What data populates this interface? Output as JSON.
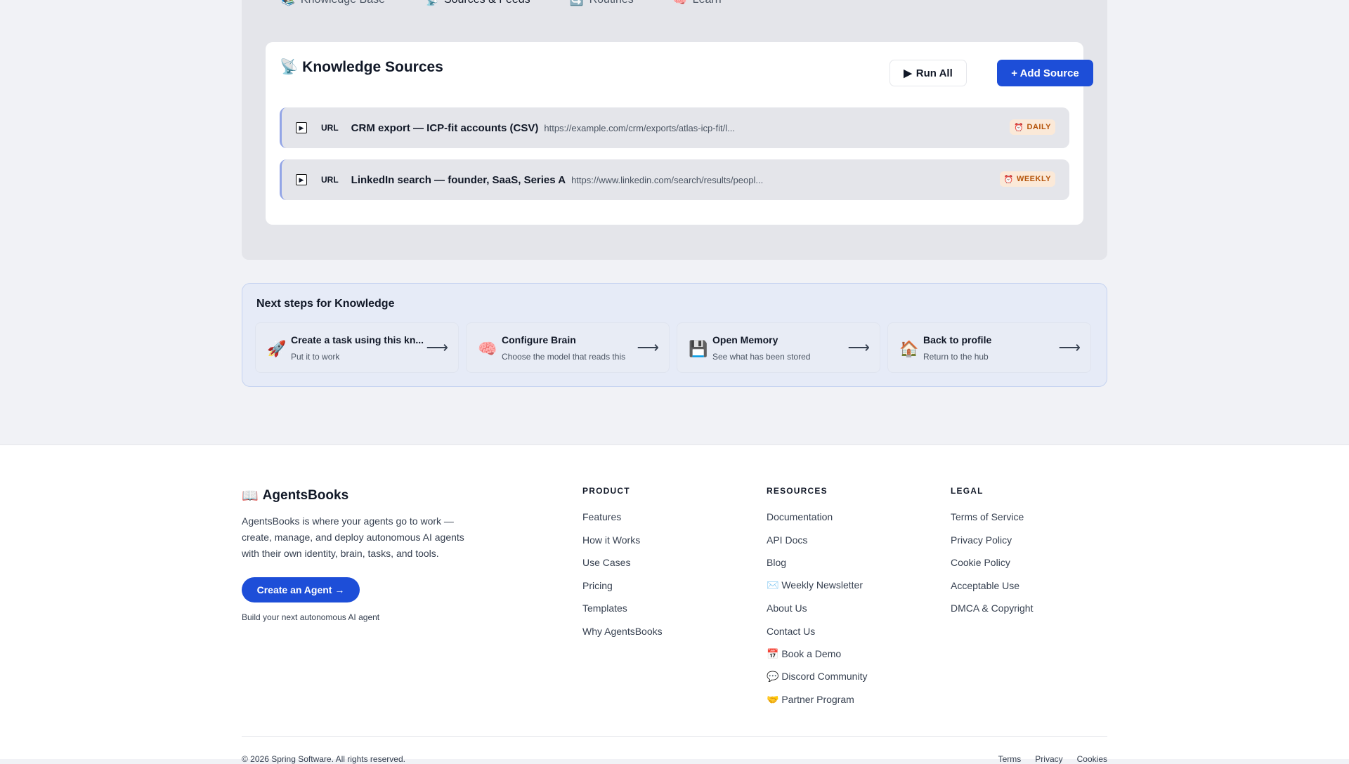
{
  "tabs": [
    {
      "icon": "📚",
      "label": "Knowledge Base"
    },
    {
      "icon": "📡",
      "label": "Sources & Feeds"
    },
    {
      "icon": "🔄",
      "label": "Routines"
    },
    {
      "icon": "🧠",
      "label": "Learn"
    }
  ],
  "sources": {
    "icon": "📡",
    "title": "Knowledge Sources",
    "run_all_label": "Run All",
    "add_label": "+ Add Source",
    "items": [
      {
        "type": "URL",
        "name": "CRM export — ICP-fit accounts (CSV)",
        "url": "https://example.com/crm/exports/atlas-icp-fit/l...",
        "schedule": "DAILY"
      },
      {
        "type": "URL",
        "name": "LinkedIn search — founder, SaaS, Series A",
        "url": "https://www.linkedin.com/search/results/peopl...",
        "schedule": "WEEKLY"
      }
    ]
  },
  "next_steps": {
    "title": "Next steps for Knowledge",
    "items": [
      {
        "icon": "🚀",
        "title": "Create a task using this kn...",
        "subtitle": "Put it to work"
      },
      {
        "icon": "🧠",
        "title": "Configure Brain",
        "subtitle": "Choose the model that reads this"
      },
      {
        "icon": "💾",
        "title": "Open Memory",
        "subtitle": "See what has been stored"
      },
      {
        "icon": "🏠",
        "title": "Back to profile",
        "subtitle": "Return to the hub"
      }
    ]
  },
  "footer": {
    "brand_icon": "📖",
    "brand": "AgentsBooks",
    "description": "AgentsBooks is where your agents go to work — create, manage, and deploy autonomous AI agents with their own identity, brain, tasks, and tools.",
    "cta_label": "Create an Agent →",
    "cta_note": "Build your next autonomous AI agent",
    "product": {
      "title": "PRODUCT",
      "links": [
        "Features",
        "How it Works",
        "Use Cases",
        "Pricing",
        "Templates",
        "Why AgentsBooks"
      ]
    },
    "resources": {
      "title": "RESOURCES",
      "links": [
        "Documentation",
        "API Docs",
        "Blog",
        "✉️ Weekly Newsletter",
        "About Us",
        "Contact Us",
        "📅 Book a Demo",
        "💬 Discord Community",
        "🤝 Partner Program"
      ]
    },
    "legal": {
      "title": "LEGAL",
      "links": [
        "Terms of Service",
        "Privacy Policy",
        "Cookie Policy",
        "Acceptable Use",
        "DMCA & Copyright"
      ]
    },
    "copyright": "© 2026 Spring Software. All rights reserved.",
    "bottom_links": [
      "Terms",
      "Privacy",
      "Cookies"
    ]
  }
}
